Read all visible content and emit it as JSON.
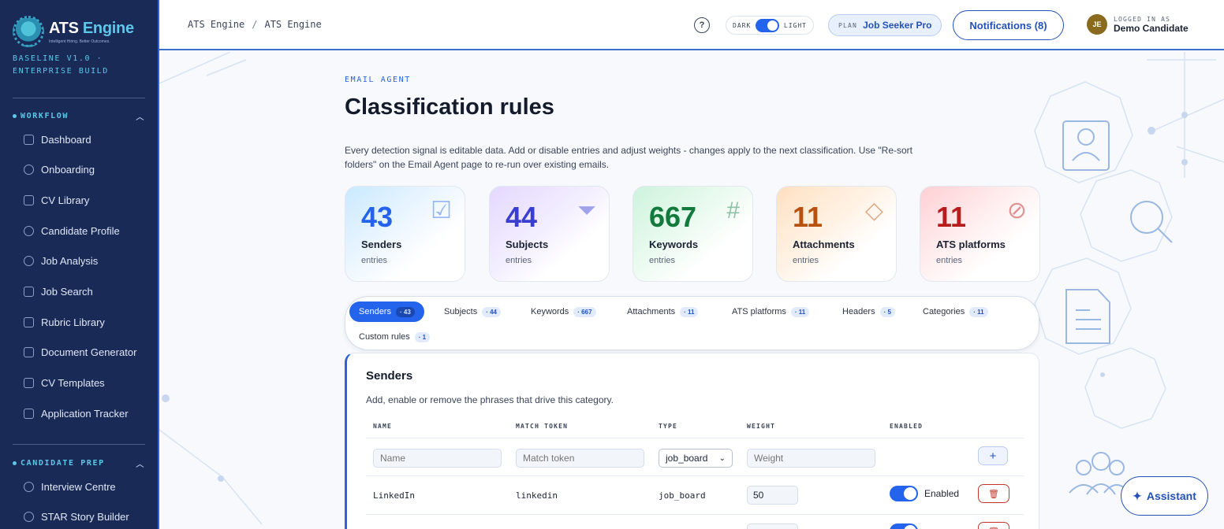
{
  "sidebar": {
    "brand": "ATS Engine",
    "brand_main": "ATS",
    "brand_accent": "Engine",
    "tagline": "Intelligent Hiring. Better Outcomes.",
    "build": "BASELINE V1.0 · ENTERPRISE BUILD",
    "sections": [
      {
        "title": "WORKFLOW",
        "items": [
          {
            "label": "Dashboard",
            "icon": "dashboard-icon"
          },
          {
            "label": "Onboarding",
            "icon": "user-plus-icon"
          },
          {
            "label": "CV Library",
            "icon": "document-icon"
          },
          {
            "label": "Candidate Profile",
            "icon": "user-icon"
          },
          {
            "label": "Job Analysis",
            "icon": "search-icon"
          },
          {
            "label": "Job Search",
            "icon": "briefcase-icon"
          },
          {
            "label": "Rubric Library",
            "icon": "book-icon"
          },
          {
            "label": "Document Generator",
            "icon": "file-export-icon"
          },
          {
            "label": "CV Templates",
            "icon": "template-icon"
          },
          {
            "label": "Application Tracker",
            "icon": "clipboard-icon"
          }
        ]
      },
      {
        "title": "CANDIDATE PREP",
        "items": [
          {
            "label": "Interview Centre",
            "icon": "chat-icon"
          },
          {
            "label": "STAR Story Builder",
            "icon": "star-icon"
          }
        ]
      }
    ]
  },
  "topbar": {
    "breadcrumb": [
      "ATS Engine",
      "ATS Engine"
    ],
    "breadcrumb_sep": "/",
    "help": "?",
    "theme_dark": "DARK",
    "theme_light": "LIGHT",
    "plan_label": "PLAN",
    "plan_value": "Job Seeker Pro",
    "notifications": "Notifications (8)",
    "user_initials": "JE",
    "user_label": "LOGGED IN AS",
    "user_name": "Demo Candidate"
  },
  "page": {
    "eyebrow": "EMAIL AGENT",
    "title": "Classification rules",
    "description": "Every detection signal is editable data. Add or disable entries and adjust weights - changes apply to the next classification. Use \"Re-sort folders\" on the Email Agent page to re-run over existing emails."
  },
  "stats": [
    {
      "value": "43",
      "label": "Senders",
      "sub": "entries",
      "color": "#2463eb",
      "icon": "checklist-icon",
      "glyph": "☑"
    },
    {
      "value": "44",
      "label": "Subjects",
      "sub": "entries",
      "color": "#3b3fd1",
      "icon": "filter-icon",
      "glyph": "⏷"
    },
    {
      "value": "667",
      "label": "Keywords",
      "sub": "entries",
      "color": "#137a3e",
      "icon": "hash-icon",
      "glyph": "#"
    },
    {
      "value": "11",
      "label": "Attachments",
      "sub": "entries",
      "color": "#b8500f",
      "icon": "tag-icon",
      "glyph": "◇"
    },
    {
      "value": "11",
      "label": "ATS platforms",
      "sub": "entries",
      "color": "#b91c1c",
      "icon": "paperclip-icon",
      "glyph": "⊘"
    }
  ],
  "tabs": [
    {
      "label": "Senders",
      "count": "· 43"
    },
    {
      "label": "Subjects",
      "count": "· 44"
    },
    {
      "label": "Keywords",
      "count": "· 667"
    },
    {
      "label": "Attachments",
      "count": "· 11"
    },
    {
      "label": "ATS platforms",
      "count": "· 11"
    },
    {
      "label": "Headers",
      "count": "· 5"
    },
    {
      "label": "Categories",
      "count": "· 11"
    },
    {
      "label": "Custom rules",
      "count": "· 1"
    }
  ],
  "panel": {
    "title": "Senders",
    "description": "Add, enable or remove the phrases that drive this category.",
    "columns": [
      "NAME",
      "MATCH TOKEN",
      "TYPE",
      "WEIGHT",
      "ENABLED"
    ],
    "new_row": {
      "name_placeholder": "Name",
      "token_placeholder": "Match token",
      "type_value": "job_board",
      "weight_placeholder": "Weight",
      "add": "+"
    },
    "rows": [
      {
        "name": "LinkedIn",
        "token": "linkedin",
        "type": "job_board",
        "weight": "50",
        "enabled": "Enabled"
      }
    ]
  },
  "assistant": "Assistant"
}
